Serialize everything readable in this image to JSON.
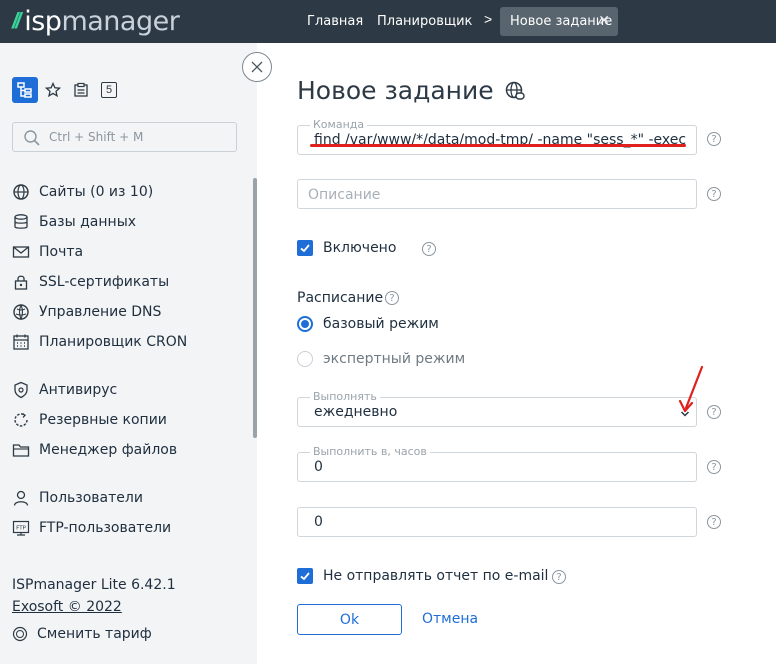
{
  "header": {
    "logo_mark": "//",
    "logo_text_a": "isp",
    "logo_text_b": "manager",
    "breadcrumbs": [
      "Главная",
      "Планировщик"
    ],
    "separator": ">",
    "active_tab": "Новое задание",
    "close_glyph": "✕"
  },
  "sidebar": {
    "tab_badge": "5",
    "search_placeholder": "Ctrl + Shift + M",
    "items": [
      {
        "label": "Сайты (0 из 10)",
        "icon": "globe-icon"
      },
      {
        "label": "Базы данных",
        "icon": "database-icon"
      },
      {
        "label": "Почта",
        "icon": "mail-icon"
      },
      {
        "label": "SSL-сертификаты",
        "icon": "lock-icon"
      },
      {
        "label": "Управление DNS",
        "icon": "dns-globe-icon"
      },
      {
        "label": "Планировщик CRON",
        "icon": "calendar-icon"
      },
      {
        "label": "Антивирус",
        "icon": "shield-icon"
      },
      {
        "label": "Резервные копии",
        "icon": "backup-icon"
      },
      {
        "label": "Менеджер файлов",
        "icon": "folder-icon"
      },
      {
        "label": "Пользователи",
        "icon": "user-icon"
      },
      {
        "label": "FTP-пользователи",
        "icon": "ftp-icon"
      }
    ],
    "version": "ISPmanager Lite 6.42.1",
    "copyright": "Exosoft © 2022",
    "tariff": "Сменить тариф"
  },
  "form": {
    "title": "Новое задание",
    "command_label": "Команда",
    "command_value": "find /var/www/*/data/mod-tmp/ -name \"sess_*\" -exec rm {} \\;",
    "description_placeholder": "Описание",
    "enabled_label": "Включено",
    "enabled": true,
    "schedule_label": "Расписание",
    "schedule_options": [
      "базовый режим",
      "экспертный режим"
    ],
    "schedule_selected": "базовый режим",
    "run_label": "Выполнять",
    "run_value": "ежедневно",
    "hour_label": "Выполнить в, часов",
    "hour_value": "0",
    "minute_value": "0",
    "no_report_label": "Не отправлять отчет по e-mail",
    "no_report": true,
    "ok_label": "Ok",
    "cancel_label": "Отмена",
    "help_glyph": "?",
    "accent_color": "#1f6ed8",
    "annotation_color": "#e0201c"
  }
}
